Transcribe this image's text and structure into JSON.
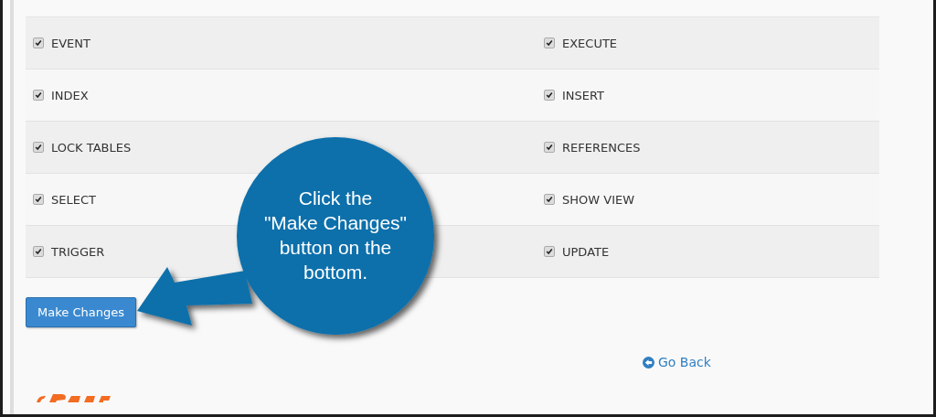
{
  "permissions": [
    [
      {
        "label": "EVENT",
        "checked": true
      },
      {
        "label": "EXECUTE",
        "checked": true
      }
    ],
    [
      {
        "label": "INDEX",
        "checked": true
      },
      {
        "label": "INSERT",
        "checked": true
      }
    ],
    [
      {
        "label": "LOCK TABLES",
        "checked": true
      },
      {
        "label": "REFERENCES",
        "checked": true
      }
    ],
    [
      {
        "label": "SELECT",
        "checked": true
      },
      {
        "label": "SHOW VIEW",
        "checked": true
      }
    ],
    [
      {
        "label": "TRIGGER",
        "checked": true
      },
      {
        "label": "UPDATE",
        "checked": true
      }
    ]
  ],
  "submit_button": "Make Changes",
  "go_back_link": "Go Back",
  "callout": {
    "lines": [
      "Click the",
      "\"Make Changes\"",
      "button on the",
      "bottom."
    ]
  }
}
